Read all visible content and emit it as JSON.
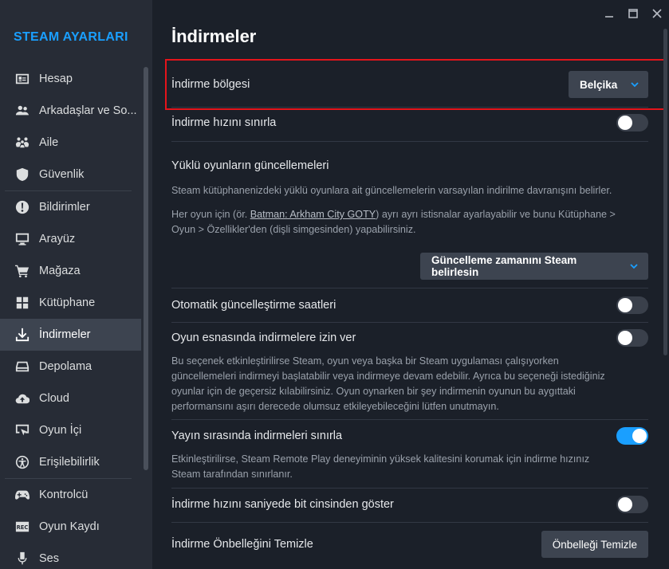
{
  "sidebar": {
    "title": "STEAM AYARLARI",
    "items": [
      {
        "label": "Hesap",
        "icon": "account-card-icon"
      },
      {
        "label": "Arkadaşlar ve So...",
        "icon": "friends-icon"
      },
      {
        "label": "Aile",
        "icon": "family-icon"
      },
      {
        "label": "Güvenlik",
        "icon": "shield-icon"
      },
      {
        "label": "Bildirimler",
        "icon": "alert-icon"
      },
      {
        "label": "Arayüz",
        "icon": "monitor-icon"
      },
      {
        "label": "Mağaza",
        "icon": "cart-icon"
      },
      {
        "label": "Kütüphane",
        "icon": "grid-icon"
      },
      {
        "label": "İndirmeler",
        "icon": "download-icon",
        "active": true
      },
      {
        "label": "Depolama",
        "icon": "drive-icon"
      },
      {
        "label": "Cloud",
        "icon": "cloud-icon"
      },
      {
        "label": "Oyun İçi",
        "icon": "ingame-icon"
      },
      {
        "label": "Erişilebilirlik",
        "icon": "accessibility-icon"
      },
      {
        "label": "Kontrolcü",
        "icon": "gamepad-icon"
      },
      {
        "label": "Oyun Kaydı",
        "icon": "rec-icon"
      },
      {
        "label": "Ses",
        "icon": "microphone-icon"
      }
    ]
  },
  "window": {
    "controls": [
      "minimize-icon",
      "maximize-icon",
      "close-icon"
    ]
  },
  "main": {
    "title": "İndirmeler",
    "download_region": {
      "label": "İndirme bölgesi",
      "value": "Belçika"
    },
    "limit_speed": {
      "label": "İndirme hızını sınırla",
      "enabled": false
    },
    "installed_updates": {
      "heading": "Yüklü oyunların güncellemeleri",
      "desc1": "Steam kütüphanenizdeki yüklü oyunlara ait güncellemelerin varsayılan indirilme davranışını belirler.",
      "desc2_prefix": "Her oyun için (ör. ",
      "desc2_link": "Batman: Arkham City GOTY",
      "desc2_suffix_line1": ") ayrı ayrı istisnalar ayarlayabilir ve bunu Kütüphane >",
      "desc2_line2": "Oyun > Özellikler'den (dişli simgesinden) yapabilirsiniz.",
      "dropdown": "Güncelleme zamanını Steam belirlesin"
    },
    "auto_update_hours": {
      "label": "Otomatik güncelleştirme saatleri",
      "enabled": false
    },
    "allow_during_game": {
      "label": "Oyun esnasında indirmelere izin ver",
      "enabled": false,
      "desc_lines": [
        "Bu seçenek etkinleştirilirse Steam, oyun veya başka bir Steam uygulaması çalışıyorken",
        "güncellemeleri indirmeyi başlatabilir veya indirmeye devam edebilir. Ayrıca bu seçeneği istediğiniz",
        "oyunlar için de geçersiz kılabilirsiniz. Oyun oynarken bir şey indirmenin oyunun bu aygıttaki",
        "performansını aşırı derecede olumsuz etkileyebileceğini lütfen unutmayın."
      ]
    },
    "throttle_streaming": {
      "label": "Yayın sırasında indirmeleri sınırla",
      "enabled": true,
      "desc_lines": [
        "Etkinleştirilirse, Steam Remote Play deneyiminin yüksek kalitesini korumak için indirme hızınız",
        "Steam tarafından sınırlanır."
      ]
    },
    "bits_per_second": {
      "label": "İndirme hızını saniyede bit cinsinden göster",
      "enabled": false
    },
    "clear_cache": {
      "label": "İndirme Önbelleğini Temizle",
      "button": "Önbelleği Temizle"
    }
  },
  "colors": {
    "accent": "#1a9fff",
    "highlight_box": "#e4141b",
    "background": "#1b2029",
    "sidebar": "#272c36"
  }
}
